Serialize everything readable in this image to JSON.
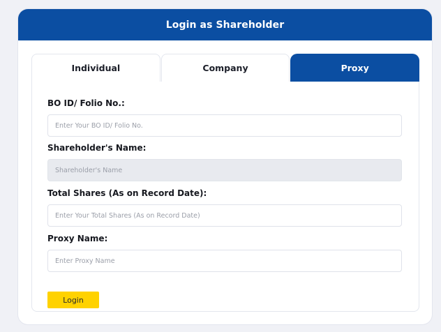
{
  "header": {
    "title": "Login as Shareholder"
  },
  "tabs": [
    {
      "label": "Individual",
      "active": false
    },
    {
      "label": "Company",
      "active": false
    },
    {
      "label": "Proxy",
      "active": true
    }
  ],
  "form": {
    "bo_id": {
      "label": "BO ID/ Folio No.:",
      "placeholder": "Enter Your BO ID/ Folio No.",
      "value": ""
    },
    "shareholder_name": {
      "label": "Shareholder's Name:",
      "placeholder": "Shareholder's Name",
      "value": "",
      "readonly": true
    },
    "total_shares": {
      "label": "Total Shares (As on Record Date):",
      "placeholder": "Enter Your Total Shares (As on Record Date)",
      "value": ""
    },
    "proxy_name": {
      "label": "Proxy Name:",
      "placeholder": "Enter Proxy Name",
      "value": ""
    },
    "submit_label": "Login"
  },
  "colors": {
    "primary": "#0b4ea2",
    "button": "#ffd200",
    "readonly_bg": "#e8eaef",
    "page_bg": "#f0f1f6"
  }
}
